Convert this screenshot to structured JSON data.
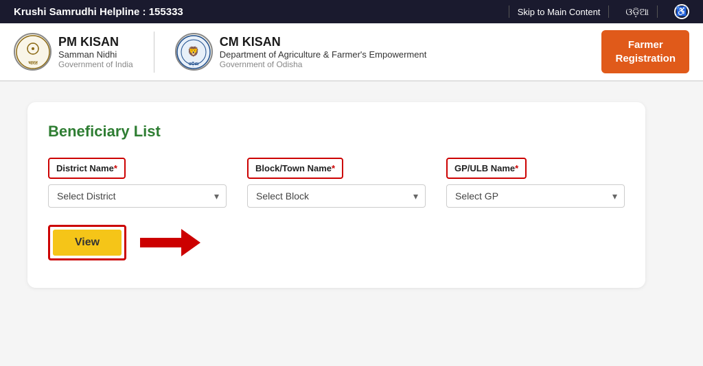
{
  "topbar": {
    "helpline_label": "Krushi Samrudhi Helpline : ",
    "helpline_number": "155333",
    "skip_link": "Skip to Main Content",
    "lang_label": "ଓଡ଼ିଆ",
    "accessibility_icon": "♿"
  },
  "header": {
    "pm_title": "PM KISAN",
    "pm_subtitle": "Samman Nidhi",
    "pm_govt": "Government of India",
    "cm_title": "CM KISAN",
    "cm_subtitle": "Department of Agriculture & Farmer's Empowerment",
    "cm_govt": "Government of Odisha",
    "farmer_reg_btn_line1": "Farmer",
    "farmer_reg_btn_line2": "Registration"
  },
  "main": {
    "card_title": "Beneficiary List",
    "district_label": "District Name",
    "district_required": "*",
    "district_placeholder": "Select District",
    "block_label": "Block/Town Name",
    "block_required": "*",
    "block_placeholder": "Select Block",
    "gp_label": "GP/ULB Name",
    "gp_required": "*",
    "gp_placeholder": "Select GP",
    "view_btn": "View"
  }
}
